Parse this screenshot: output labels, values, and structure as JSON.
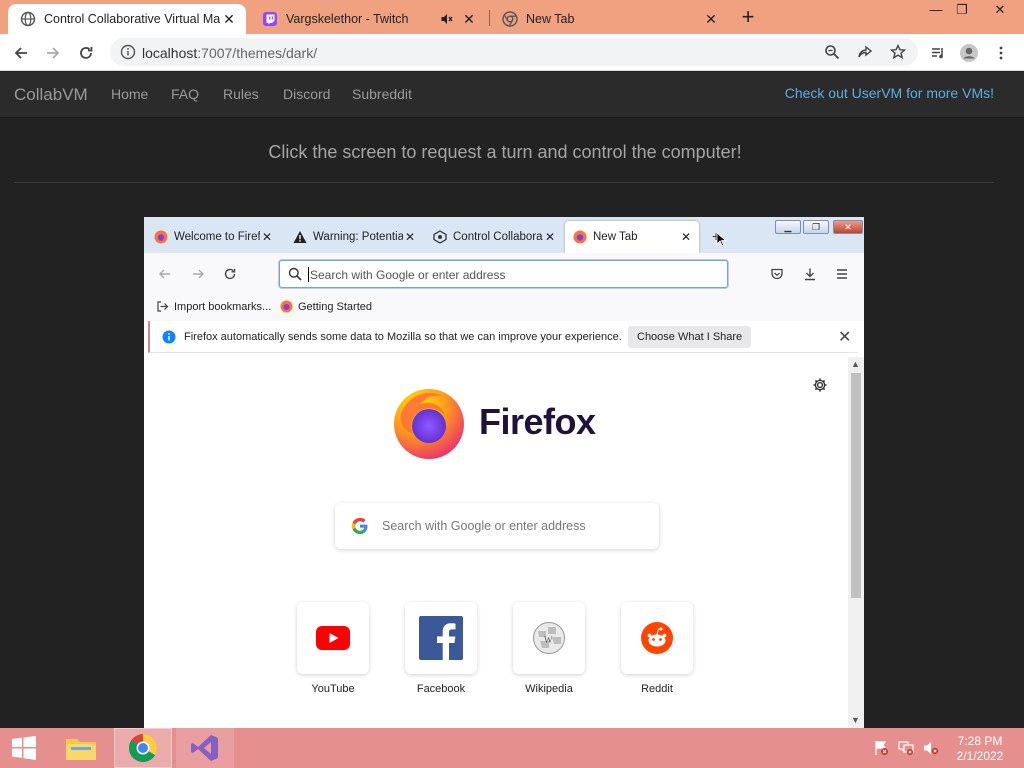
{
  "chrome": {
    "tabs": [
      {
        "title": "Control Collaborative Virtual Ma",
        "close": "✕"
      },
      {
        "title": "Vargskelethor - Twitch",
        "close": "✕"
      },
      {
        "title": "New Tab",
        "close": "✕"
      }
    ],
    "new_tab": "+",
    "url_host": "localhost",
    "url_path": ":7007/themes/dark/"
  },
  "collabvm": {
    "brand": "CollabVM",
    "nav": [
      "Home",
      "FAQ",
      "Rules",
      "Discord",
      "Subreddit"
    ],
    "promo": "Check out UserVM for more VMs!",
    "headline": "Click the screen to request a turn and control the computer!"
  },
  "vm": {
    "firefox": {
      "tabs": [
        {
          "title": "Welcome to Firefo",
          "close": "✕"
        },
        {
          "title": "Warning: Potentia",
          "close": "✕"
        },
        {
          "title": "Control Collabora",
          "close": "✕"
        },
        {
          "title": "New Tab",
          "close": "✕"
        }
      ],
      "new_tab": "+",
      "url_placeholder": "Search with Google or enter address",
      "bookmarks": [
        "Import bookmarks...",
        "Getting Started"
      ],
      "notice": {
        "text": "Firefox automatically sends some data to Mozilla so that we can improve your experience.",
        "button": "Choose What I Share",
        "close": "✕"
      },
      "wordmark": "Firefox",
      "search_placeholder": "Search with Google or enter address",
      "top_sites": [
        "YouTube",
        "Facebook",
        "Wikipedia",
        "Reddit"
      ]
    }
  },
  "taskbar": {
    "time": "7:28 PM",
    "date": "2/1/2022"
  },
  "colors": {
    "chrome_tabbar": "#f0a180",
    "taskbar": "#e58f8f",
    "collabvm_bg": "#222222",
    "promo_link": "#5dade2",
    "firefox_wordmark": "#20123a"
  }
}
